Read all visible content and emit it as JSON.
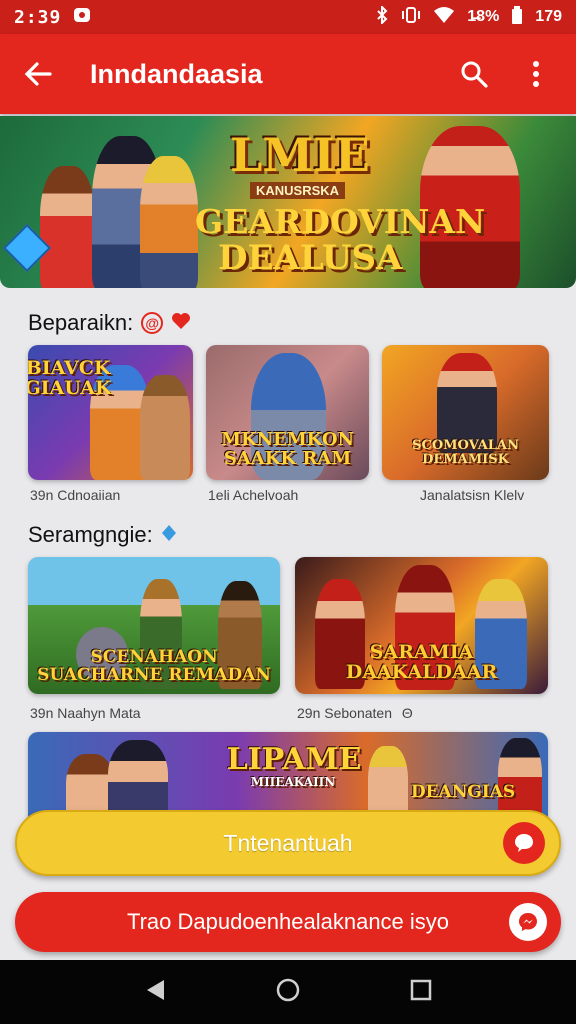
{
  "status_bar": {
    "time": "2:39",
    "battery_text": "1̶8%",
    "right_text": "179",
    "icons": [
      "app-notification-icon",
      "bluetooth-icon",
      "vibrate-icon",
      "wifi-icon",
      "battery-icon"
    ]
  },
  "app_bar": {
    "title": "Inndandaasia",
    "icons": [
      "back-arrow-icon",
      "search-icon",
      "more-vert-icon"
    ]
  },
  "banner": {
    "line1": "LMIE",
    "line2": "KANUSRSKA",
    "line3": "GEARDOVINAN",
    "line4": "DEALUSA"
  },
  "section1": {
    "title": "Beparaikn:",
    "badges": [
      "@",
      "heart-icon"
    ],
    "cards": [
      {
        "caption": "BIAVCK\nGIAUAK",
        "label": "39n Cdnoaiian"
      },
      {
        "caption": "MKNEMKON\nSAAKK RAM",
        "label": "1eli Achelvoah"
      },
      {
        "caption": "SCOMOVALAN\nDEMAMISK",
        "label": "Janalatsisn Klelv"
      }
    ]
  },
  "section2": {
    "title": "Seramgngie:",
    "badge": "diamond-icon",
    "cards": [
      {
        "caption": "SCENAHAON\nSUACHARNE REMADAN",
        "label": "39n Naahyn Mata"
      },
      {
        "caption": "SARAMIA\nDAAKALDAAR",
        "label": "29n Sebonaten"
      }
    ],
    "card2_label_icon": "Θ"
  },
  "promo_banner": {
    "line1": "LIPAME",
    "line2": "MIIEAKAIIN",
    "line3": "DEANGIAS"
  },
  "buttons": {
    "primary_label": "Tntenantuah",
    "secondary_label": "Trao Dapudoenhealaknance isyo",
    "primary_color": "#f3ca2f",
    "secondary_color": "#e3271f"
  },
  "nav": {
    "icons": [
      "nav-back-icon",
      "nav-home-icon",
      "nav-recents-icon"
    ]
  },
  "colors": {
    "accent": "#e3271f",
    "status": "#c9201a"
  }
}
